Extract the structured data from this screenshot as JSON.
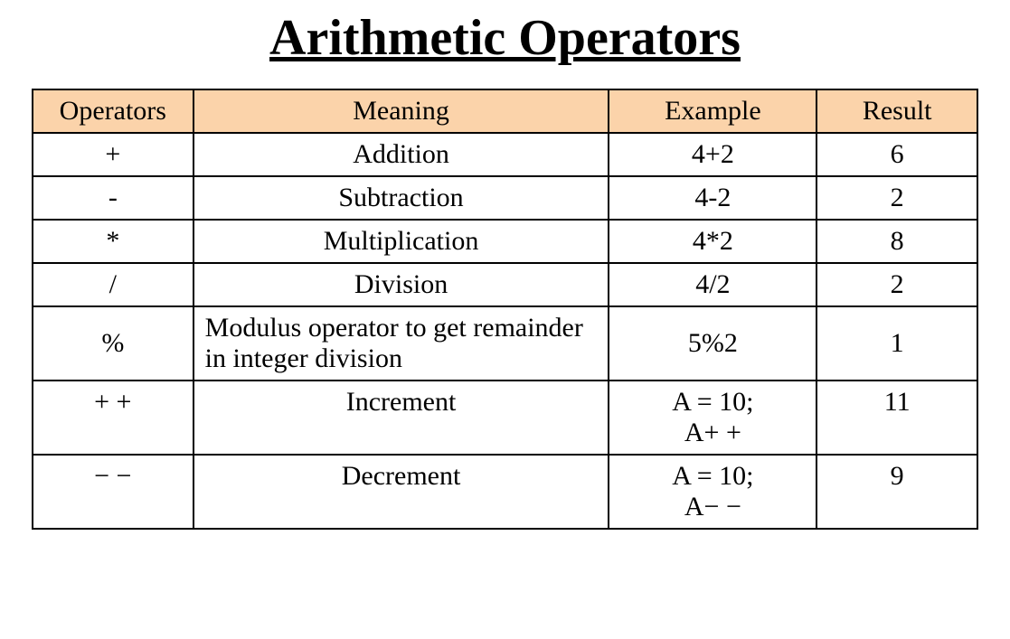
{
  "title": "Arithmetic Operators",
  "headers": {
    "operators": "Operators",
    "meaning": "Meaning",
    "example": "Example",
    "result": "Result"
  },
  "rows": [
    {
      "op": "+",
      "meaning": "Addition",
      "meaning_align": "center",
      "example": "4+2",
      "example_multiline": false,
      "result": "6",
      "op_valign": "middle",
      "res_valign": "middle"
    },
    {
      "op": "-",
      "meaning": "Subtraction",
      "meaning_align": "center",
      "example": "4-2",
      "example_multiline": false,
      "result": "2",
      "op_valign": "middle",
      "res_valign": "middle"
    },
    {
      "op": "*",
      "meaning": "Multiplication",
      "meaning_align": "center",
      "example": "4*2",
      "example_multiline": false,
      "result": "8",
      "op_valign": "middle",
      "res_valign": "middle"
    },
    {
      "op": "/",
      "meaning": "Division",
      "meaning_align": "center",
      "example": "4/2",
      "example_multiline": false,
      "result": "2",
      "op_valign": "middle",
      "res_valign": "middle"
    },
    {
      "op": "%",
      "meaning": "Modulus operator to get remainder in integer division",
      "meaning_align": "left",
      "example": "5%2",
      "example_multiline": false,
      "result": "1",
      "op_valign": "middle",
      "res_valign": "middle"
    },
    {
      "op": "+ +",
      "meaning": "Increment",
      "meaning_align": "center",
      "example_line1": "A = 10;",
      "example_line2": "A+ +",
      "example_multiline": true,
      "result": "11",
      "op_valign": "top",
      "res_valign": "top"
    },
    {
      "op": "− −",
      "meaning": "Decrement",
      "meaning_align": "center",
      "example_line1": "A = 10;",
      "example_line2": "A− −",
      "example_multiline": true,
      "result": "9",
      "op_valign": "top",
      "res_valign": "top"
    }
  ]
}
